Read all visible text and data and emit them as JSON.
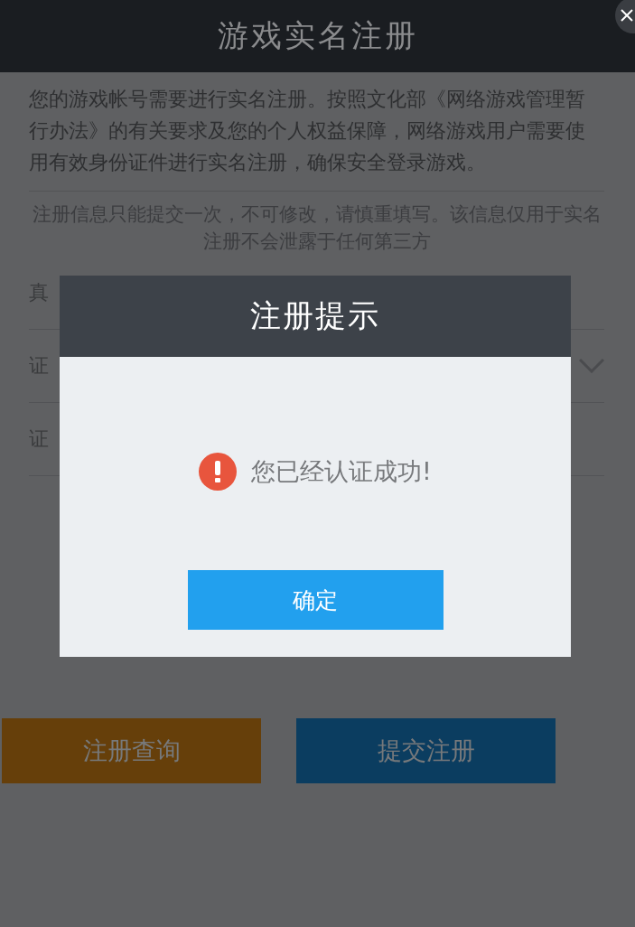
{
  "header": {
    "title": "游戏实名注册"
  },
  "intro": "您的游戏帐号需要进行实名注册。按照文化部《网络游戏管理暂行办法》的有关要求及您的个人权益保障，网络游戏用户需要使用有效身份证件进行实名注册，确保安全登录游戏。",
  "notice": "注册信息只能提交一次，不可修改，请慎重填写。该信息仅用于实名注册不会泄露于任何第三方",
  "form_rows": [
    {
      "label": "真",
      "kind": "text"
    },
    {
      "label": "证",
      "kind": "select"
    },
    {
      "label": "证",
      "kind": "text"
    }
  ],
  "buttons": [
    {
      "label": "注册查询",
      "kind": "query"
    },
    {
      "label": "提交注册",
      "kind": "submit"
    }
  ],
  "dialog": {
    "title": "注册提示",
    "message": "您已经认证成功!",
    "confirm": "确定"
  }
}
